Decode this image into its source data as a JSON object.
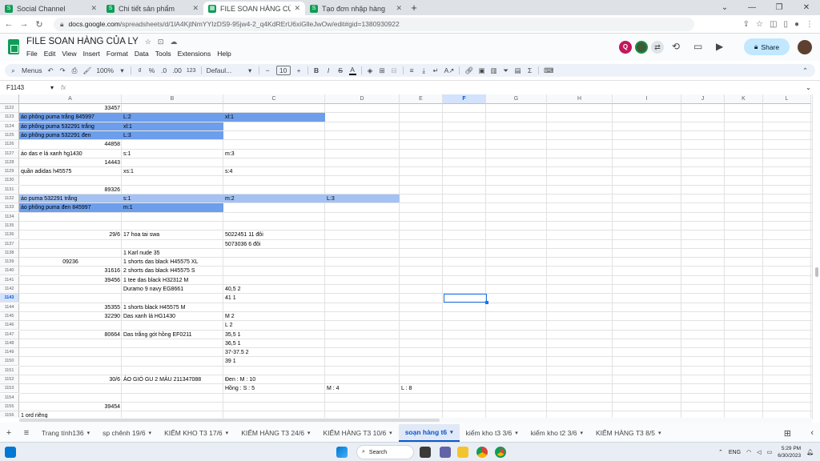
{
  "browser": {
    "tabs": [
      {
        "title": "Social Channel",
        "active": false
      },
      {
        "title": "Chi tiết sản phẩm",
        "active": false
      },
      {
        "title": "FILE SOAN HÀNG CỦA LY - Goo",
        "active": true
      },
      {
        "title": "Tạo đơn nhập hàng",
        "active": false
      }
    ],
    "url_domain": "docs.google.com",
    "url_path": "/spreadsheets/d/1lA4KjtNmYYIzDS9-95jw4-2_q4KdRErU6xiGlleJwOw/edit#gid=1380930922"
  },
  "doc": {
    "title": "FILE SOAN HÀNG CỦA LY",
    "menu": [
      "File",
      "Edit",
      "View",
      "Insert",
      "Format",
      "Data",
      "Tools",
      "Extensions",
      "Help"
    ],
    "share_label": "Share",
    "avatar_letter": "Q"
  },
  "toolbar": {
    "menus_label": "Menus",
    "zoom": "100%",
    "currency": "₫",
    "percent": "%",
    "dec_less": ".0",
    "dec_more": ".00",
    "number_format": "123",
    "font": "Defaul...",
    "font_size": "10"
  },
  "formula_bar": {
    "cell_ref": "F1143",
    "fx": "fx",
    "content": ""
  },
  "columns": [
    "A",
    "B",
    "C",
    "D",
    "E",
    "F",
    "G",
    "H",
    "I",
    "J",
    "K",
    "L"
  ],
  "selected_column": "F",
  "selected_row": "1143",
  "rows": [
    {
      "n": "1122",
      "A": "33457",
      "A_align": "r"
    },
    {
      "n": "1123",
      "A": "áo phông puma trắng 845997",
      "B": "L:2",
      "C": "xl:1",
      "hl": "dark",
      "hl_to": "D"
    },
    {
      "n": "1124",
      "A": "áo phông puma 532291 trắng",
      "B": "xl:1",
      "hl": "dark",
      "hl_to": "C"
    },
    {
      "n": "1125",
      "A": "áo phông puma 532291 đen",
      "B": "L:3",
      "hl": "dark",
      "hl_to": "C"
    },
    {
      "n": "1126",
      "A": "44858",
      "A_align": "r"
    },
    {
      "n": "1127",
      "A": "áo das e lá xanh hg1430",
      "B": "s:1",
      "C": "m:3"
    },
    {
      "n": "1128",
      "A": "14443",
      "A_align": "r"
    },
    {
      "n": "1129",
      "A": "quần adidas h45575",
      "B": "xs:1",
      "C": "s:4"
    },
    {
      "n": "1130"
    },
    {
      "n": "1131",
      "A": "89326",
      "A_align": "r"
    },
    {
      "n": "1132",
      "A": "áo puma 532291 trắng",
      "B": "s:1",
      "C": "m:2",
      "D": "L:3",
      "hl": "light",
      "hl_to": "E"
    },
    {
      "n": "1133",
      "A": "áo phông puma đen 845997",
      "B": "m:1",
      "hl": "dark",
      "hl_to": "C"
    },
    {
      "n": "1134"
    },
    {
      "n": "1135"
    },
    {
      "n": "1136",
      "A": "29/6",
      "A_align": "r",
      "B": "17 hoa tai swa",
      "C": "5022451 11 đôi"
    },
    {
      "n": "1137",
      "C": "5073036 6 đôi"
    },
    {
      "n": "1138",
      "B": "1 Karl nude 35"
    },
    {
      "n": "1139",
      "A": "09236",
      "A_align": "c",
      "B": "1 shorts das black H45575 XL"
    },
    {
      "n": "1140",
      "A": "31616",
      "A_align": "r",
      "B": "2 shorts das black H45575 S"
    },
    {
      "n": "1141",
      "A": "39456",
      "A_align": "r",
      "B": "1 tee das black H32312 M"
    },
    {
      "n": "1142",
      "B": "Duramo 9 navy EG8661",
      "C": "40,5 2"
    },
    {
      "n": "1143",
      "C": "41 1"
    },
    {
      "n": "1144",
      "A": "35355",
      "A_align": "r",
      "B": "1 shorts black H45575 M"
    },
    {
      "n": "1145",
      "A": "32290",
      "A_align": "r",
      "B": "Das xanh lá HG1430",
      "C": "M 2"
    },
    {
      "n": "1146",
      "C": "L 2"
    },
    {
      "n": "1147",
      "A": "80664",
      "A_align": "r",
      "B": "Das trắng gót hồng EF0211",
      "C": "35,5 1"
    },
    {
      "n": "1148",
      "C": "36,5 1"
    },
    {
      "n": "1149",
      "C": "37-37.5 2"
    },
    {
      "n": "1150",
      "C": "39 1"
    },
    {
      "n": "1151"
    },
    {
      "n": "1152",
      "A": "30/6",
      "A_align": "r",
      "B": "ÁO GIÓ GU 2 MÀU 211347088",
      "C": "Đen : M : 10"
    },
    {
      "n": "1153",
      "C": "Hồng : S : 5",
      "D": "M : 4",
      "E": "L : 8"
    },
    {
      "n": "1154"
    },
    {
      "n": "1155",
      "A": "39454",
      "A_align": "r"
    },
    {
      "n": "1156",
      "A": "1 ord riêng"
    }
  ],
  "sheet_tabs": [
    {
      "label": "Trang tính136",
      "active": false
    },
    {
      "label": "sp chênh 19/6",
      "active": false
    },
    {
      "label": "KIỂM KHO T3 17/6",
      "active": false
    },
    {
      "label": "KIỂM HÀNG T3 24/6",
      "active": false
    },
    {
      "label": "KIỂM HÀNG T3 10/6",
      "active": false
    },
    {
      "label": "soạn hàng t6",
      "active": true
    },
    {
      "label": "kiểm kho t3 3/6",
      "active": false
    },
    {
      "label": "kiểm kho t2 3/6",
      "active": false
    },
    {
      "label": "KIỂM HÀNG T3 8/5",
      "active": false
    }
  ],
  "taskbar": {
    "search_label": "Search",
    "lang": "ENG",
    "time": "5:29 PM",
    "date": "6/30/2023"
  },
  "colors": {
    "highlight_dark": "#6d9eeb",
    "highlight_light": "#a4c2f4",
    "selection": "#1a73e8",
    "sheets_green": "#0f9d58"
  }
}
